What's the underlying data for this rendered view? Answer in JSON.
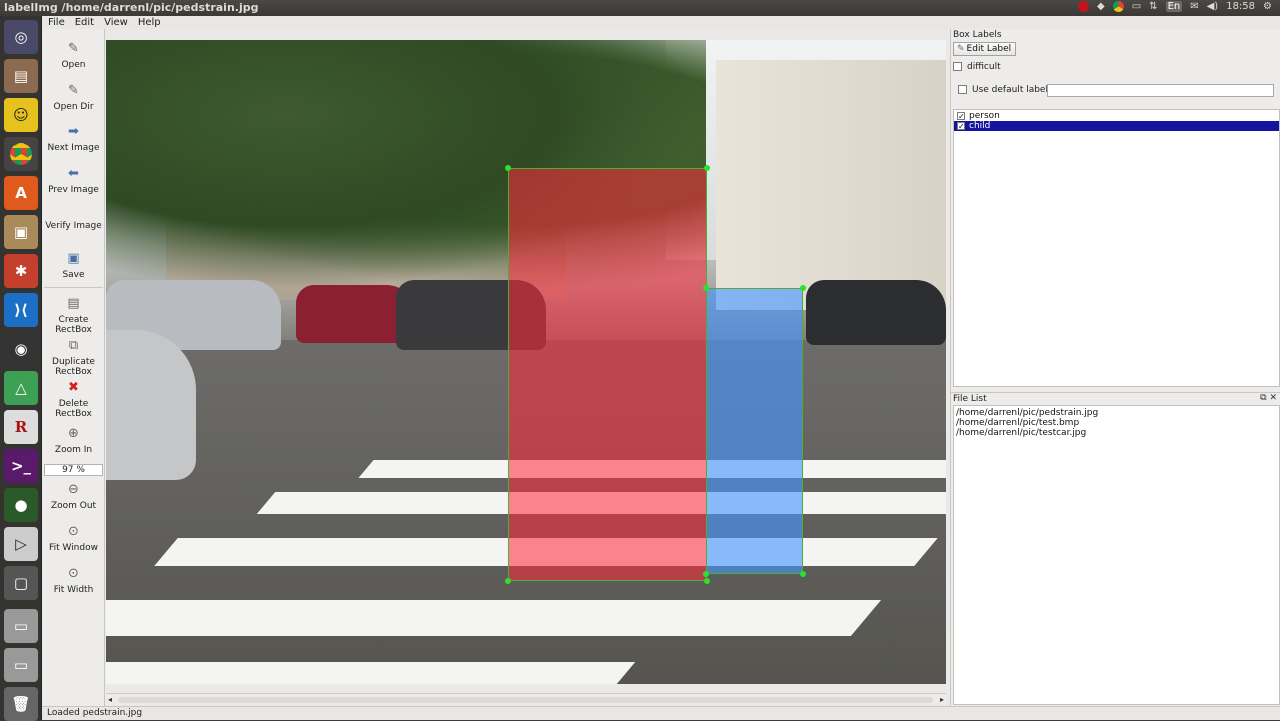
{
  "window": {
    "title": "labelImg /home/darrenl/pic/pedstrain.jpg"
  },
  "system_tray": {
    "language": "En",
    "time": "18:58"
  },
  "menu": {
    "file": "File",
    "edit": "Edit",
    "view": "View",
    "help": "Help"
  },
  "toolbar": {
    "open": "Open",
    "open_dir": "Open Dir",
    "next_image": "Next Image",
    "prev_image": "Prev Image",
    "verify_image": "Verify Image",
    "save": "Save",
    "create_rectbox": "Create RectBox",
    "duplicate_rectbox": "Duplicate RectBox",
    "delete_rectbox": "Delete RectBox",
    "zoom_in": "Zoom In",
    "zoom_value": "97 %",
    "zoom_out": "Zoom Out",
    "fit_window": "Fit Window",
    "fit_width": "Fit Width"
  },
  "box_labels": {
    "title": "Box Labels",
    "edit_label_button": "Edit Label",
    "difficult": "difficult",
    "use_default_label": "Use default label",
    "default_label_value": "",
    "labels": [
      {
        "name": "person",
        "checked": true,
        "selected": false
      },
      {
        "name": "child",
        "checked": true,
        "selected": true
      }
    ]
  },
  "file_list": {
    "title": "File List",
    "files": [
      "/home/darrenl/pic/pedstrain.jpg",
      "/home/darrenl/pic/test.bmp",
      "/home/darrenl/pic/testcar.jpg"
    ]
  },
  "status": {
    "message": "Loaded pedstrain.jpg"
  },
  "colors": {
    "person_box": "#ff283c",
    "child_box": "#4696ff",
    "selection": "#1414a0",
    "handle": "#2ee02e"
  }
}
